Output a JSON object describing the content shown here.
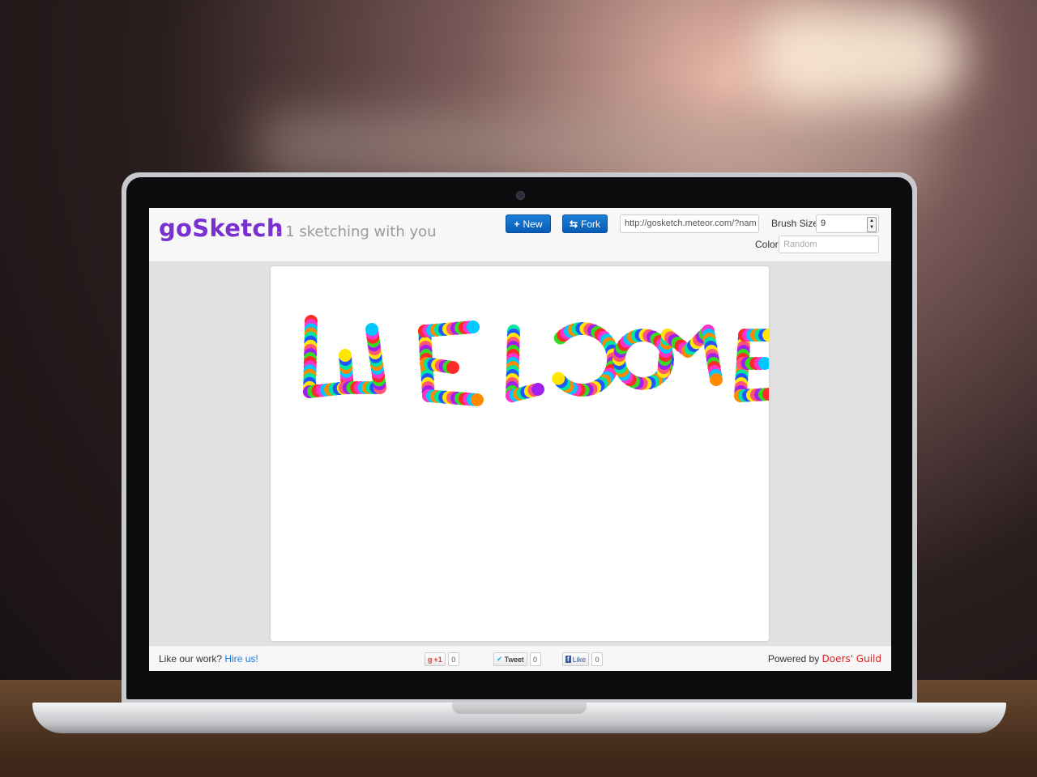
{
  "app": {
    "logo": "goSketch",
    "tagline": "- 1 sketching with you"
  },
  "toolbar": {
    "new_label": "New",
    "fork_label": "Fork",
    "url_value": "http://gosketch.meteor.com/?nam",
    "brush_size_label": "Brush Size",
    "brush_size_value": "9",
    "color_label": "Color",
    "color_placeholder": "Random"
  },
  "canvas": {
    "drawing_text": "WELCOME"
  },
  "footer": {
    "left_text": "Like our work?",
    "hire_link": "Hire us!",
    "gplus_label": "+1",
    "gplus_count": "0",
    "tweet_label": "Tweet",
    "tweet_count": "0",
    "like_label": "Like",
    "like_count": "0",
    "powered_by": "Powered by",
    "doers_link": "Doers' Guild"
  },
  "icons": {
    "new": "plus-icon",
    "fork": "fork-icon",
    "gplus": "google-plus-icon",
    "tweet": "twitter-icon",
    "like": "facebook-icon"
  },
  "colors": {
    "logo": "#7a2fd1",
    "primary_button": "#0a5bb5",
    "link": "#1a78d0",
    "doers_link": "#e02020"
  }
}
